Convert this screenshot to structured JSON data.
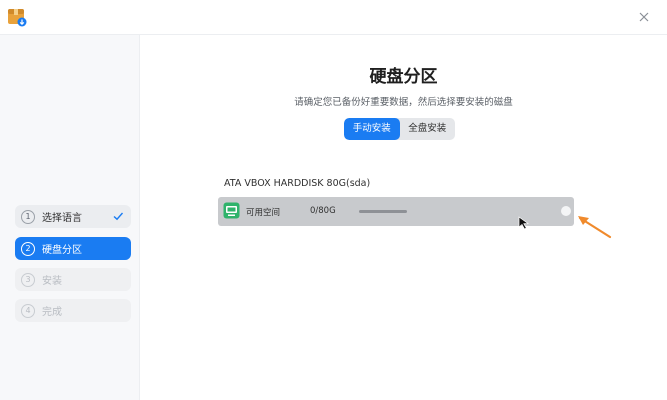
{
  "titlebar": {
    "app_icon": "installer-package-icon",
    "close_icon": "close-icon"
  },
  "sidebar": {
    "steps": [
      {
        "number": "1",
        "label": "选择语言",
        "state": "done"
      },
      {
        "number": "2",
        "label": "硬盘分区",
        "state": "active"
      },
      {
        "number": "3",
        "label": "安装",
        "state": "pending"
      },
      {
        "number": "4",
        "label": "完成",
        "state": "pending"
      }
    ]
  },
  "main": {
    "title": "硬盘分区",
    "subtitle": "请确定您已备份好重要数据，然后选择要安装的磁盘",
    "modes": [
      {
        "label": "手动安装",
        "selected": true
      },
      {
        "label": "全盘安装",
        "selected": false
      }
    ],
    "disk": {
      "label": "ATA VBOX HARDDISK 80G(sda)",
      "partitions": [
        {
          "name": "可用空间",
          "size": "0/80G",
          "used_fraction": 0
        }
      ]
    }
  },
  "colors": {
    "accent": "#1a7cf2",
    "annotation_arrow": "#f08a2c"
  }
}
